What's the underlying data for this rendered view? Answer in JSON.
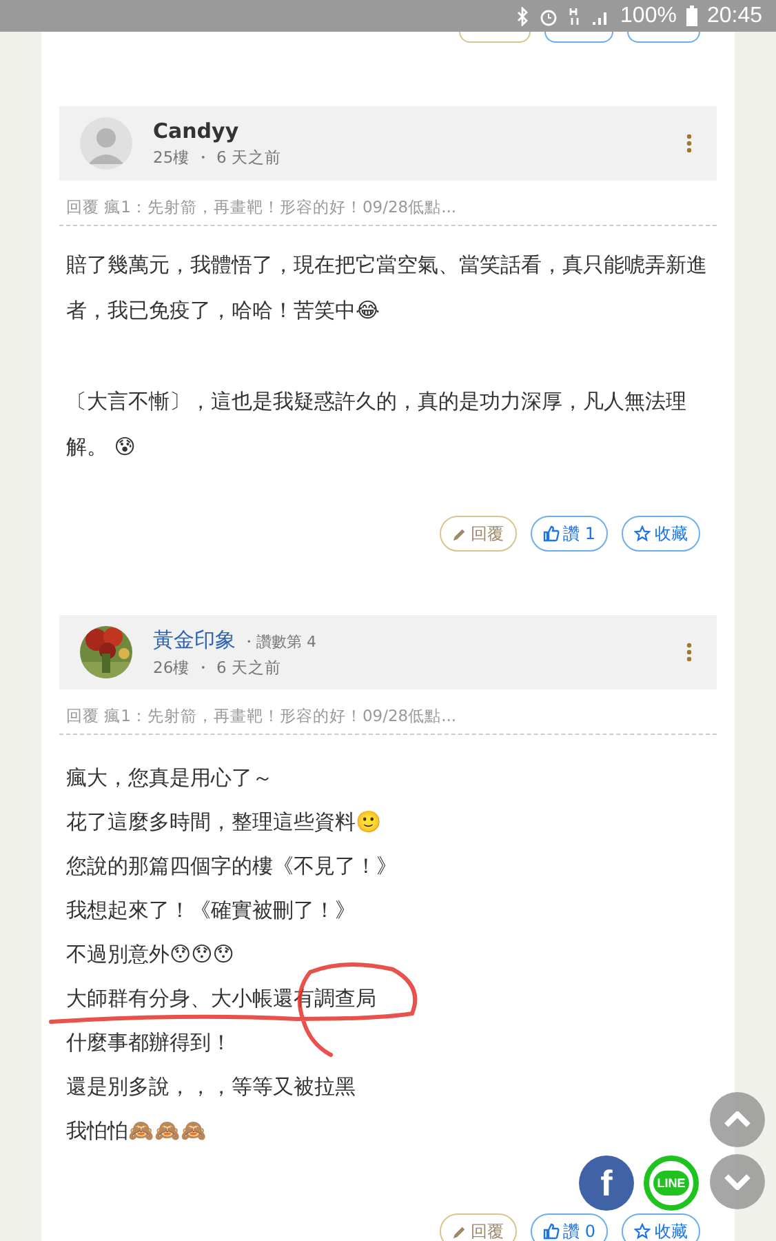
{
  "status_bar": {
    "battery": "100%",
    "time": "20:45"
  },
  "top_partial_actions": [
    {
      "kind": "reply"
    },
    {
      "kind": "like"
    },
    {
      "kind": "favorite"
    }
  ],
  "posts": [
    {
      "author": "Candyy",
      "linked": false,
      "avatar": {
        "kind": "default"
      },
      "meta": "25樓 ・ 6 天之前",
      "reply_quote": "回覆 瘋1：先射箭，再畫靶！形容的好！09/28低點...",
      "paragraphs": [
        {
          "kind": "block",
          "text": "賠了幾萬元，我體悟了，現在把它當空氣、當笑話看，真只能唬弄新進者，我已免疫了，哈哈！苦笑中😂"
        },
        {
          "kind": "block",
          "text": "〔大言不慚〕，這也是我疑惑許久的，真的是功力深厚，凡人無法理解。 😰"
        }
      ],
      "actions": [
        {
          "kind": "reply",
          "label": "回覆"
        },
        {
          "kind": "like",
          "label": "讚 1"
        },
        {
          "kind": "favorite",
          "label": "收藏"
        }
      ]
    },
    {
      "author": "黃金印象",
      "linked": true,
      "badge": "・讚數第 4",
      "meta": "26樓 ・ 6 天之前",
      "reply_quote": "回覆 瘋1：先射箭，再畫靶！形容的好！09/28低點...",
      "paragraphs": [
        {
          "kind": "line",
          "text": "瘋大，您真是用心了～"
        },
        {
          "kind": "line",
          "text": "花了這麼多時間，整理這些資料🙂"
        },
        {
          "kind": "line",
          "text": "您說的那篇四個字的樓《不見了！》"
        },
        {
          "kind": "line",
          "text": "我想起來了！《確實被刪了！》"
        },
        {
          "kind": "line",
          "text": "不過別意外😯😯😯"
        },
        {
          "kind": "line",
          "text": "大師群有分身、大小帳還有調查局",
          "annotated": true
        },
        {
          "kind": "line",
          "text": "什麼事都辦得到！"
        },
        {
          "kind": "line",
          "text": "還是別多說，，，等等又被拉黑"
        },
        {
          "kind": "line",
          "text": "我怕怕🙈🙈🙈"
        }
      ],
      "actions": [
        {
          "kind": "reply",
          "label": "回覆"
        },
        {
          "kind": "like",
          "label": "讚 0"
        },
        {
          "kind": "favorite",
          "label": "收藏"
        }
      ]
    }
  ],
  "share_buttons": [
    {
      "kind": "facebook",
      "label": "f"
    },
    {
      "kind": "line",
      "label": "LINE"
    }
  ],
  "scroll_buttons": [
    {
      "kind": "up"
    },
    {
      "kind": "down"
    }
  ]
}
